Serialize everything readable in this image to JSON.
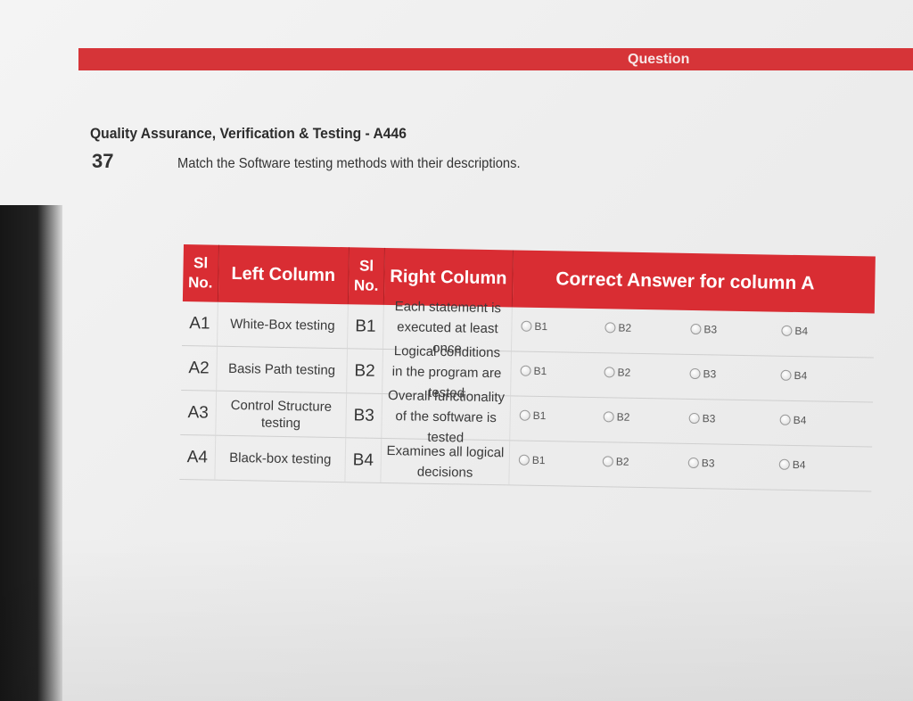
{
  "header": {
    "title": "Question"
  },
  "question": {
    "subject": "Quality Assurance, Verification & Testing - A446",
    "number": "37",
    "text": "Match the Software testing methods with their descriptions."
  },
  "table": {
    "headers": {
      "sl_line1": "Sl",
      "sl_line2": "No.",
      "left": "Left Column",
      "right": "Right Column",
      "answer": "Correct Answer for column A"
    },
    "rows": [
      {
        "a_code": "A1",
        "left": "White-Box testing",
        "b_code": "B1",
        "right": "Each statement is executed at least once"
      },
      {
        "a_code": "A2",
        "left": "Basis Path testing",
        "b_code": "B2",
        "right": "Logical conditions in the program are tested"
      },
      {
        "a_code": "A3",
        "left": "Control Structure testing",
        "b_code": "B3",
        "right": "Overall functionality of the software is tested"
      },
      {
        "a_code": "A4",
        "left": "Black-box testing",
        "b_code": "B4",
        "right": "Examines all logical decisions"
      }
    ],
    "options": [
      "B1",
      "B2",
      "B3",
      "B4"
    ]
  },
  "colors": {
    "header_bar": "#d63438",
    "table_header": "#d92d33"
  }
}
